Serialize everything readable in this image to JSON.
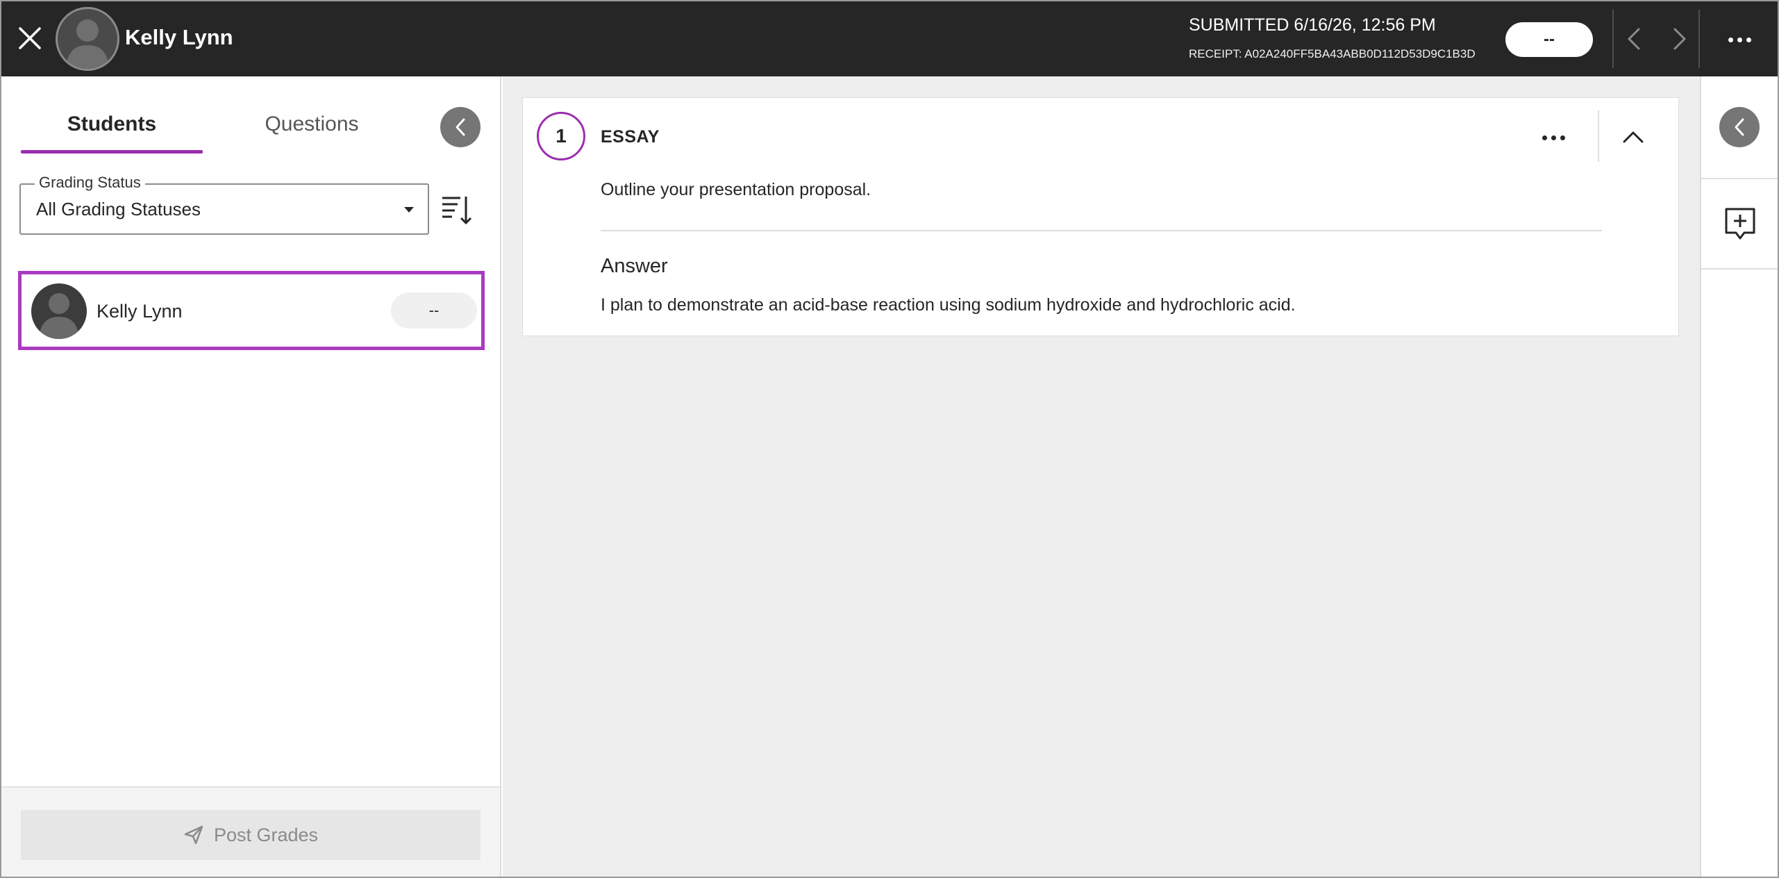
{
  "topbar": {
    "student_name": "Kelly Lynn",
    "submitted": "SUBMITTED 6/16/26, 12:56 PM",
    "receipt": "RECEIPT: A02A240FF5BA43ABB0D112D53D9C1B3D",
    "grade": "--",
    "icons": [
      "close-icon",
      "avatar-icon",
      "chevron-left-icon",
      "chevron-right-icon",
      "more-icon"
    ]
  },
  "left_panel": {
    "tabs": [
      {
        "label": "Students",
        "active": true
      },
      {
        "label": "Questions",
        "active": false
      }
    ],
    "grading_status": {
      "label": "Grading Status",
      "value": "All Grading Statuses"
    },
    "students": [
      {
        "name": "Kelly Lynn",
        "grade": "--",
        "selected": true
      }
    ],
    "post_grades_label": "Post Grades"
  },
  "question": {
    "number": "1",
    "type": "ESSAY",
    "prompt": "Outline your presentation proposal.",
    "answer_heading": "Answer",
    "answer_text": "I plan to demonstrate an acid-base reaction using sodium hydroxide and hydrochloric acid."
  },
  "colors": {
    "topbar_bg": "#262626",
    "accent_purple": "#9b2fae",
    "main_bg": "#eeeeee",
    "collapse_button": "#767676"
  }
}
